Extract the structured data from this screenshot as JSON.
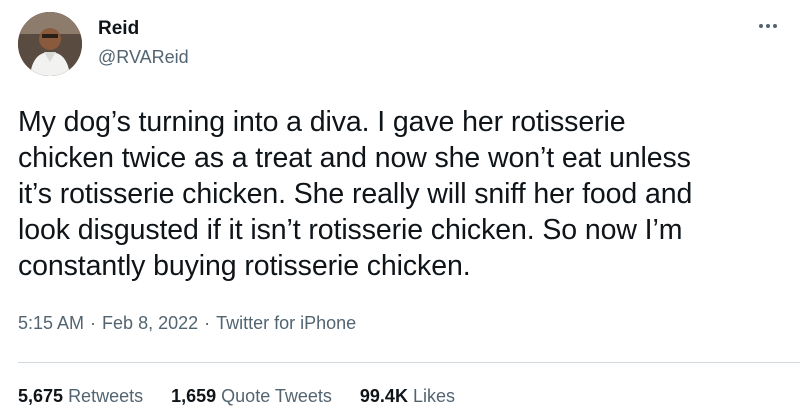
{
  "author": {
    "name": "Reid",
    "handle": "@RVAReid"
  },
  "tweet": {
    "text": "My dog’s turning into a diva. I gave her rotisserie\nchicken twice as a treat and now she won’t eat unless\nit’s rotisserie chicken. She really will sniff her food and\nlook disgusted if it isn’t rotisserie chicken. So now I’m\nconstantly buying rotisserie chicken.",
    "time": "5:15 AM",
    "date": "Feb 8, 2022",
    "source": "Twitter for iPhone",
    "separator": "·"
  },
  "stats": {
    "retweets_count": "5,675",
    "retweets_label": "Retweets",
    "quotes_count": "1,659",
    "quotes_label": "Quote Tweets",
    "likes_count": "99.4K",
    "likes_label": "Likes"
  },
  "icons": {
    "avatar": "avatar-photo",
    "more": "more-options-icon"
  },
  "colors": {
    "primary_text": "#0f1419",
    "secondary_text": "#536471",
    "divider": "#cfd9de"
  }
}
